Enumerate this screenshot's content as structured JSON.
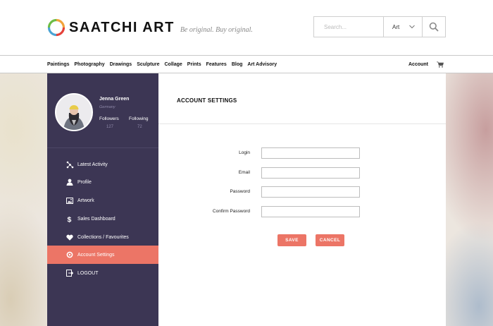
{
  "header": {
    "logo_text": "SAATCHI ART",
    "tagline": "Be original. Buy original.",
    "search_placeholder": "Search...",
    "category_selected": "Art"
  },
  "nav": {
    "items": [
      "Paintings",
      "Photography",
      "Drawings",
      "Sculpture",
      "Collage",
      "Prints",
      "Features",
      "Blog",
      "Art Advisory"
    ],
    "account_label": "Account"
  },
  "profile": {
    "name": "Jenna Green",
    "location": "Germany",
    "followers_label": "Followers",
    "followers_count": "127",
    "following_label": "Following",
    "following_count": "72"
  },
  "sidebar": {
    "items": [
      {
        "label": "Latest Activity",
        "icon": "activity-icon"
      },
      {
        "label": "Profile",
        "icon": "user-icon"
      },
      {
        "label": "Artwork",
        "icon": "image-icon"
      },
      {
        "label": "Sales Dashboard",
        "icon": "dollar-icon"
      },
      {
        "label": "Collections / Favourites",
        "icon": "heart-icon"
      },
      {
        "label": "Account Settings",
        "icon": "gear-icon",
        "active": true
      },
      {
        "label": "LOGOUT",
        "icon": "logout-icon"
      }
    ]
  },
  "main": {
    "title": "ACCOUNT SETTINGS",
    "fields": [
      {
        "label": "Login",
        "value": ""
      },
      {
        "label": "Email",
        "value": ""
      },
      {
        "label": "Password",
        "value": ""
      },
      {
        "label": "Confirm Password",
        "value": ""
      }
    ],
    "save_label": "SAVE",
    "cancel_label": "CANCEL"
  },
  "colors": {
    "sidebar_bg": "#3c3654",
    "accent": "#ec7566",
    "muted_text": "#8e88a8"
  }
}
